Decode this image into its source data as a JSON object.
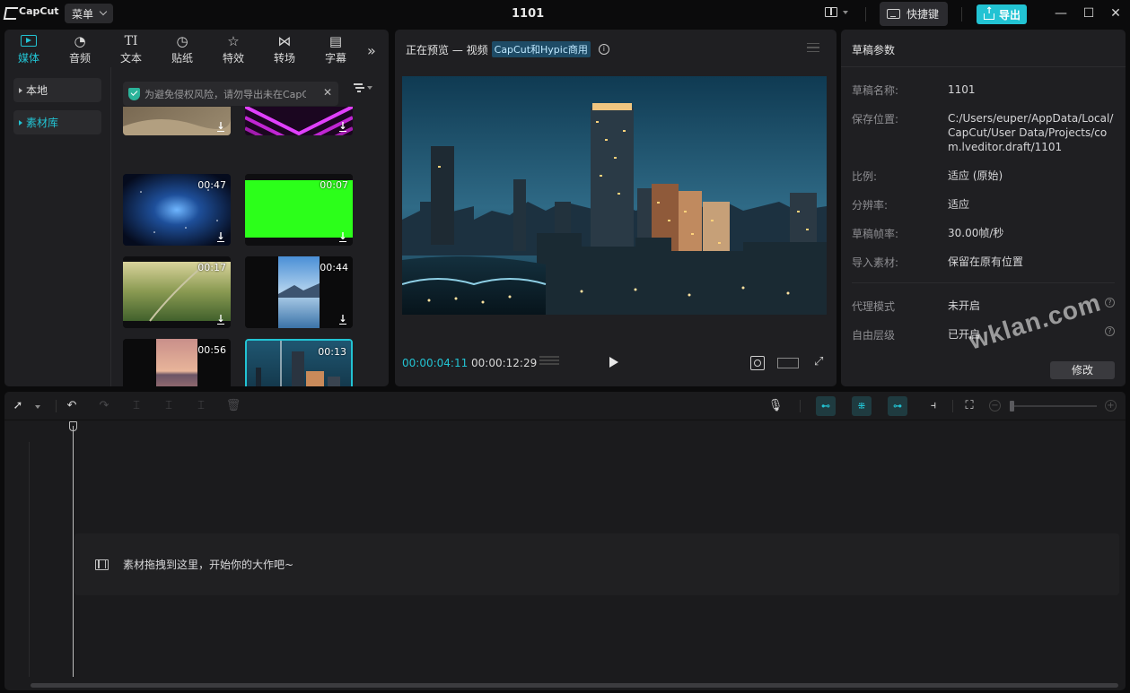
{
  "app": {
    "logo_text": "CapCut",
    "menu_label": "菜单",
    "project_title": "1101",
    "shortcut_label": "快捷键",
    "export_label": "导出"
  },
  "media": {
    "tabs": [
      {
        "label": "媒体",
        "icon": "media-icon",
        "active": true
      },
      {
        "label": "音频",
        "icon": "audio-icon"
      },
      {
        "label": "文本",
        "icon": "text-icon"
      },
      {
        "label": "贴纸",
        "icon": "sticker-icon"
      },
      {
        "label": "特效",
        "icon": "effects-icon"
      },
      {
        "label": "转场",
        "icon": "transition-icon"
      },
      {
        "label": "字幕",
        "icon": "caption-icon"
      }
    ],
    "side_nav": [
      {
        "label": "本地"
      },
      {
        "label": "素材库",
        "active": true
      }
    ],
    "notice_text": "为避免侵权风险，请勿导出未在CapCut",
    "thumbnails": [
      {
        "duration": "",
        "kind": "desert"
      },
      {
        "duration": "",
        "kind": "neon"
      },
      {
        "duration": "00:47",
        "kind": "space"
      },
      {
        "duration": "00:07",
        "kind": "greenscreen"
      },
      {
        "duration": "00:17",
        "kind": "aerial"
      },
      {
        "duration": "00:44",
        "kind": "lake"
      },
      {
        "duration": "00:56",
        "kind": "sunset"
      },
      {
        "duration": "00:13",
        "kind": "city",
        "selected": true
      }
    ]
  },
  "preview": {
    "header_prefix": "正在预览 — 视频",
    "badge": "CapCut和Hypic商用",
    "current_time": "00:00:04:11",
    "total_time": "00:00:12:29"
  },
  "params": {
    "title": "草稿参数",
    "rows": [
      {
        "label": "草稿名称:",
        "value": "1101"
      },
      {
        "label": "保存位置:",
        "value": "C:/Users/euper/AppData/Local/CapCut/User Data/Projects/com.lveditor.draft/1101"
      },
      {
        "label": "比例:",
        "value": "适应 (原始)"
      },
      {
        "label": "分辨率:",
        "value": "适应"
      },
      {
        "label": "草稿帧率:",
        "value": "30.00帧/秒"
      },
      {
        "label": "导入素材:",
        "value": "保留在原有位置"
      },
      {
        "label": "代理模式",
        "value": "未开启"
      },
      {
        "label": "自由层级",
        "value": "已开启"
      }
    ],
    "edit_label": "修改",
    "watermark": "wklan.com"
  },
  "timeline": {
    "drop_hint": "素材拖拽到这里，开始你的大作吧~"
  },
  "colors": {
    "accent": "#22c3d3",
    "panel": "#1f1f22",
    "background": "#0b0b0c"
  }
}
